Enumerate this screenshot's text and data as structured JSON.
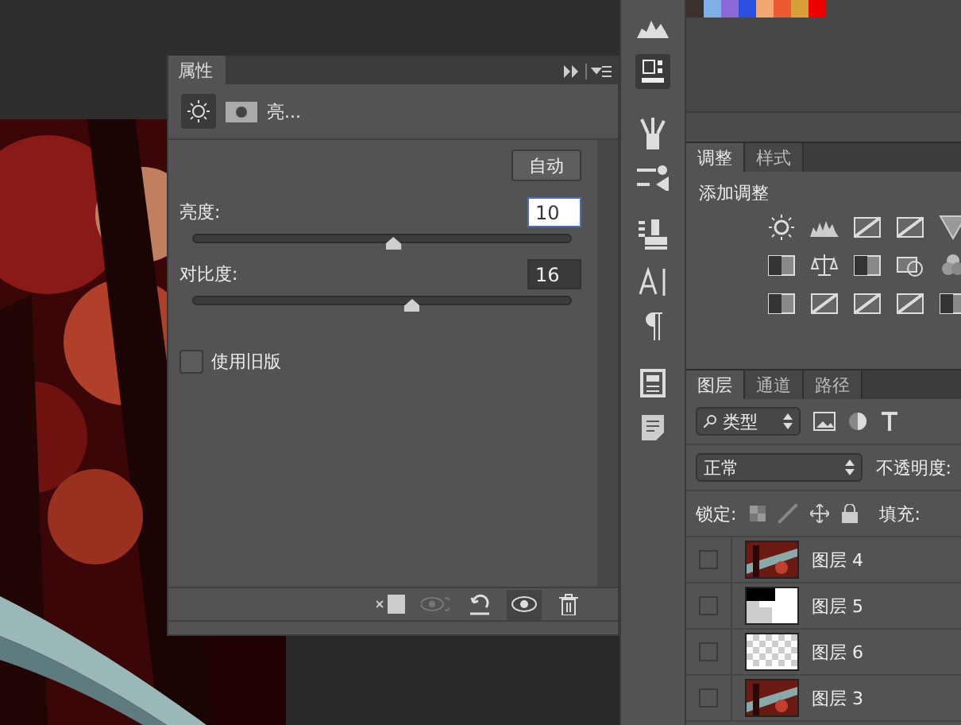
{
  "properties_panel": {
    "title": "属性",
    "subtitle": "亮...",
    "auto_button": "自动",
    "sliders": [
      {
        "label": "亮度:",
        "value": "10",
        "level": 0.53,
        "focused": true
      },
      {
        "label": "对比度:",
        "value": "16",
        "level": 0.58,
        "focused": false
      }
    ],
    "legacy": {
      "label": "使用旧版",
      "checked": false
    }
  },
  "swatches": [
    {
      "color": "#3a302c"
    },
    {
      "color": "#7fb0e6"
    },
    {
      "color": "#8a68d8"
    },
    {
      "color": "#2b4fe0"
    },
    {
      "color": "#f2a670"
    },
    {
      "color": "#ee5a30"
    },
    {
      "color": "#d8a038"
    },
    {
      "color": "#ee0000"
    }
  ],
  "adjustments": {
    "tabs": [
      {
        "label": "调整",
        "selected": true
      },
      {
        "label": "样式",
        "selected": false
      }
    ],
    "heading": "添加调整"
  },
  "layers": {
    "tabs": [
      {
        "label": "图层",
        "selected": true
      },
      {
        "label": "通道",
        "selected": false
      },
      {
        "label": "路径",
        "selected": false
      }
    ],
    "filter": "类型",
    "blend_mode": "正常",
    "opacity_label": "不透明度:",
    "lock_label": "锁定:",
    "fill_label": "填充:",
    "rows": [
      {
        "name": "图层 4"
      },
      {
        "name": "图层 5",
        "kind": "mask"
      },
      {
        "name": "图层 6",
        "kind": "transparent"
      },
      {
        "name": "图层 3"
      }
    ]
  }
}
